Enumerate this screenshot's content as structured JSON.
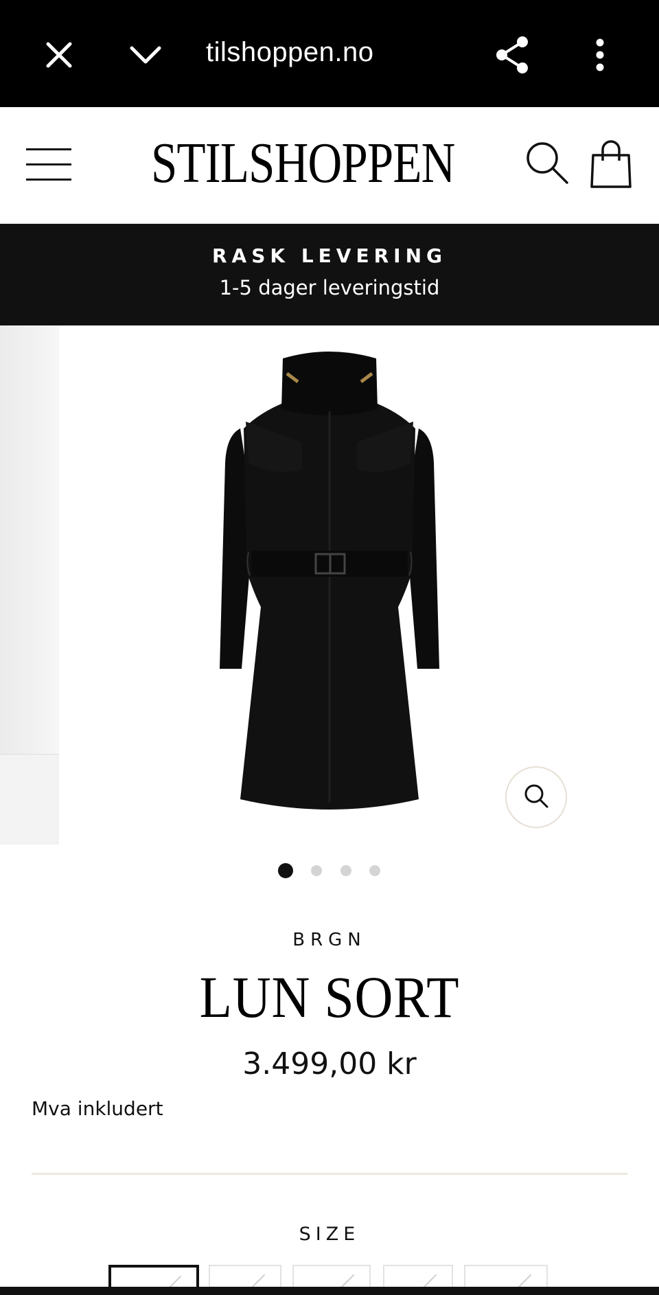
{
  "browser": {
    "url": "tilshoppen.no",
    "icons": {
      "close": "close-icon",
      "collapse": "chevron-down-icon",
      "share": "share-icon",
      "more": "more-vertical-icon"
    }
  },
  "header": {
    "logo": "STILSHOPPEN",
    "icons": {
      "menu": "hamburger-icon",
      "search": "search-icon",
      "cart": "shopping-bag-icon"
    }
  },
  "announcement": {
    "title": "RASK LEVERING",
    "subtitle": "1-5 dager leveringstid"
  },
  "gallery": {
    "slide_count": 4,
    "active_slide": 1,
    "zoom_icon": "zoom-icon"
  },
  "product": {
    "brand": "BRGN",
    "title": "LUN SORT",
    "price": "3.499,00 kr",
    "vat_note": "Mva inkludert",
    "size_label": "SIZE",
    "size_option_count": 5,
    "selected_size_index": 0
  },
  "colors": {
    "accent": "#111111",
    "announcement_bg": "#111111",
    "browser_bar_bg": "#000000",
    "divider": "#ece8df"
  }
}
